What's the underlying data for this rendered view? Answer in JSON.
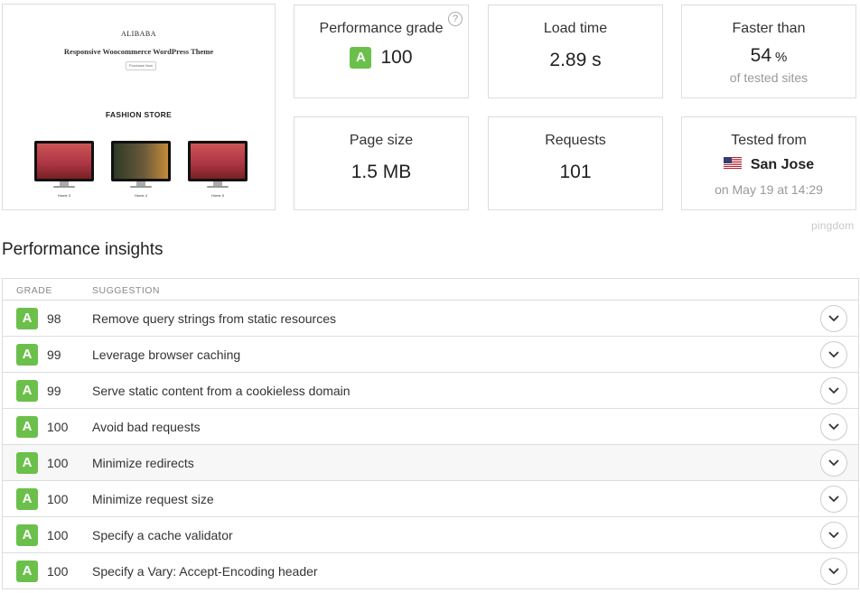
{
  "thumbnail": {
    "brand": "ALIBABA",
    "title": "Responsive Woocommerce WordPress Theme",
    "button": "Purchase Now",
    "store_heading": "FASHION STORE",
    "monitors": [
      {
        "caption": "Home 3",
        "color": "#b84a5a"
      },
      {
        "caption": "Home 4",
        "color": "#5a5030"
      },
      {
        "caption": "Home 5",
        "color": "#b84a5a"
      }
    ]
  },
  "metrics": {
    "performance_grade": {
      "label": "Performance grade",
      "grade": "A",
      "value": "100"
    },
    "load_time": {
      "label": "Load time",
      "value": "2.89 s"
    },
    "faster_than": {
      "label": "Faster than",
      "value": "54",
      "unit": "%",
      "sub": "of tested sites"
    },
    "page_size": {
      "label": "Page size",
      "value": "1.5 MB"
    },
    "requests": {
      "label": "Requests",
      "value": "101"
    },
    "tested_from": {
      "label": "Tested from",
      "location": "San Jose",
      "sub": "on May 19 at 14:29"
    }
  },
  "watermark": "pingdom",
  "insights": {
    "heading": "Performance insights",
    "columns": {
      "grade": "GRADE",
      "suggestion": "SUGGESTION"
    },
    "rows": [
      {
        "grade": "A",
        "score": "98",
        "suggestion": "Remove query strings from static resources"
      },
      {
        "grade": "A",
        "score": "99",
        "suggestion": "Leverage browser caching"
      },
      {
        "grade": "A",
        "score": "99",
        "suggestion": "Serve static content from a cookieless domain"
      },
      {
        "grade": "A",
        "score": "100",
        "suggestion": "Avoid bad requests"
      },
      {
        "grade": "A",
        "score": "100",
        "suggestion": "Minimize redirects"
      },
      {
        "grade": "A",
        "score": "100",
        "suggestion": "Minimize request size"
      },
      {
        "grade": "A",
        "score": "100",
        "suggestion": "Specify a cache validator"
      },
      {
        "grade": "A",
        "score": "100",
        "suggestion": "Specify a Vary: Accept-Encoding header"
      }
    ]
  },
  "colors": {
    "grade_green": "#6bc04b",
    "border": "#dddddd"
  }
}
